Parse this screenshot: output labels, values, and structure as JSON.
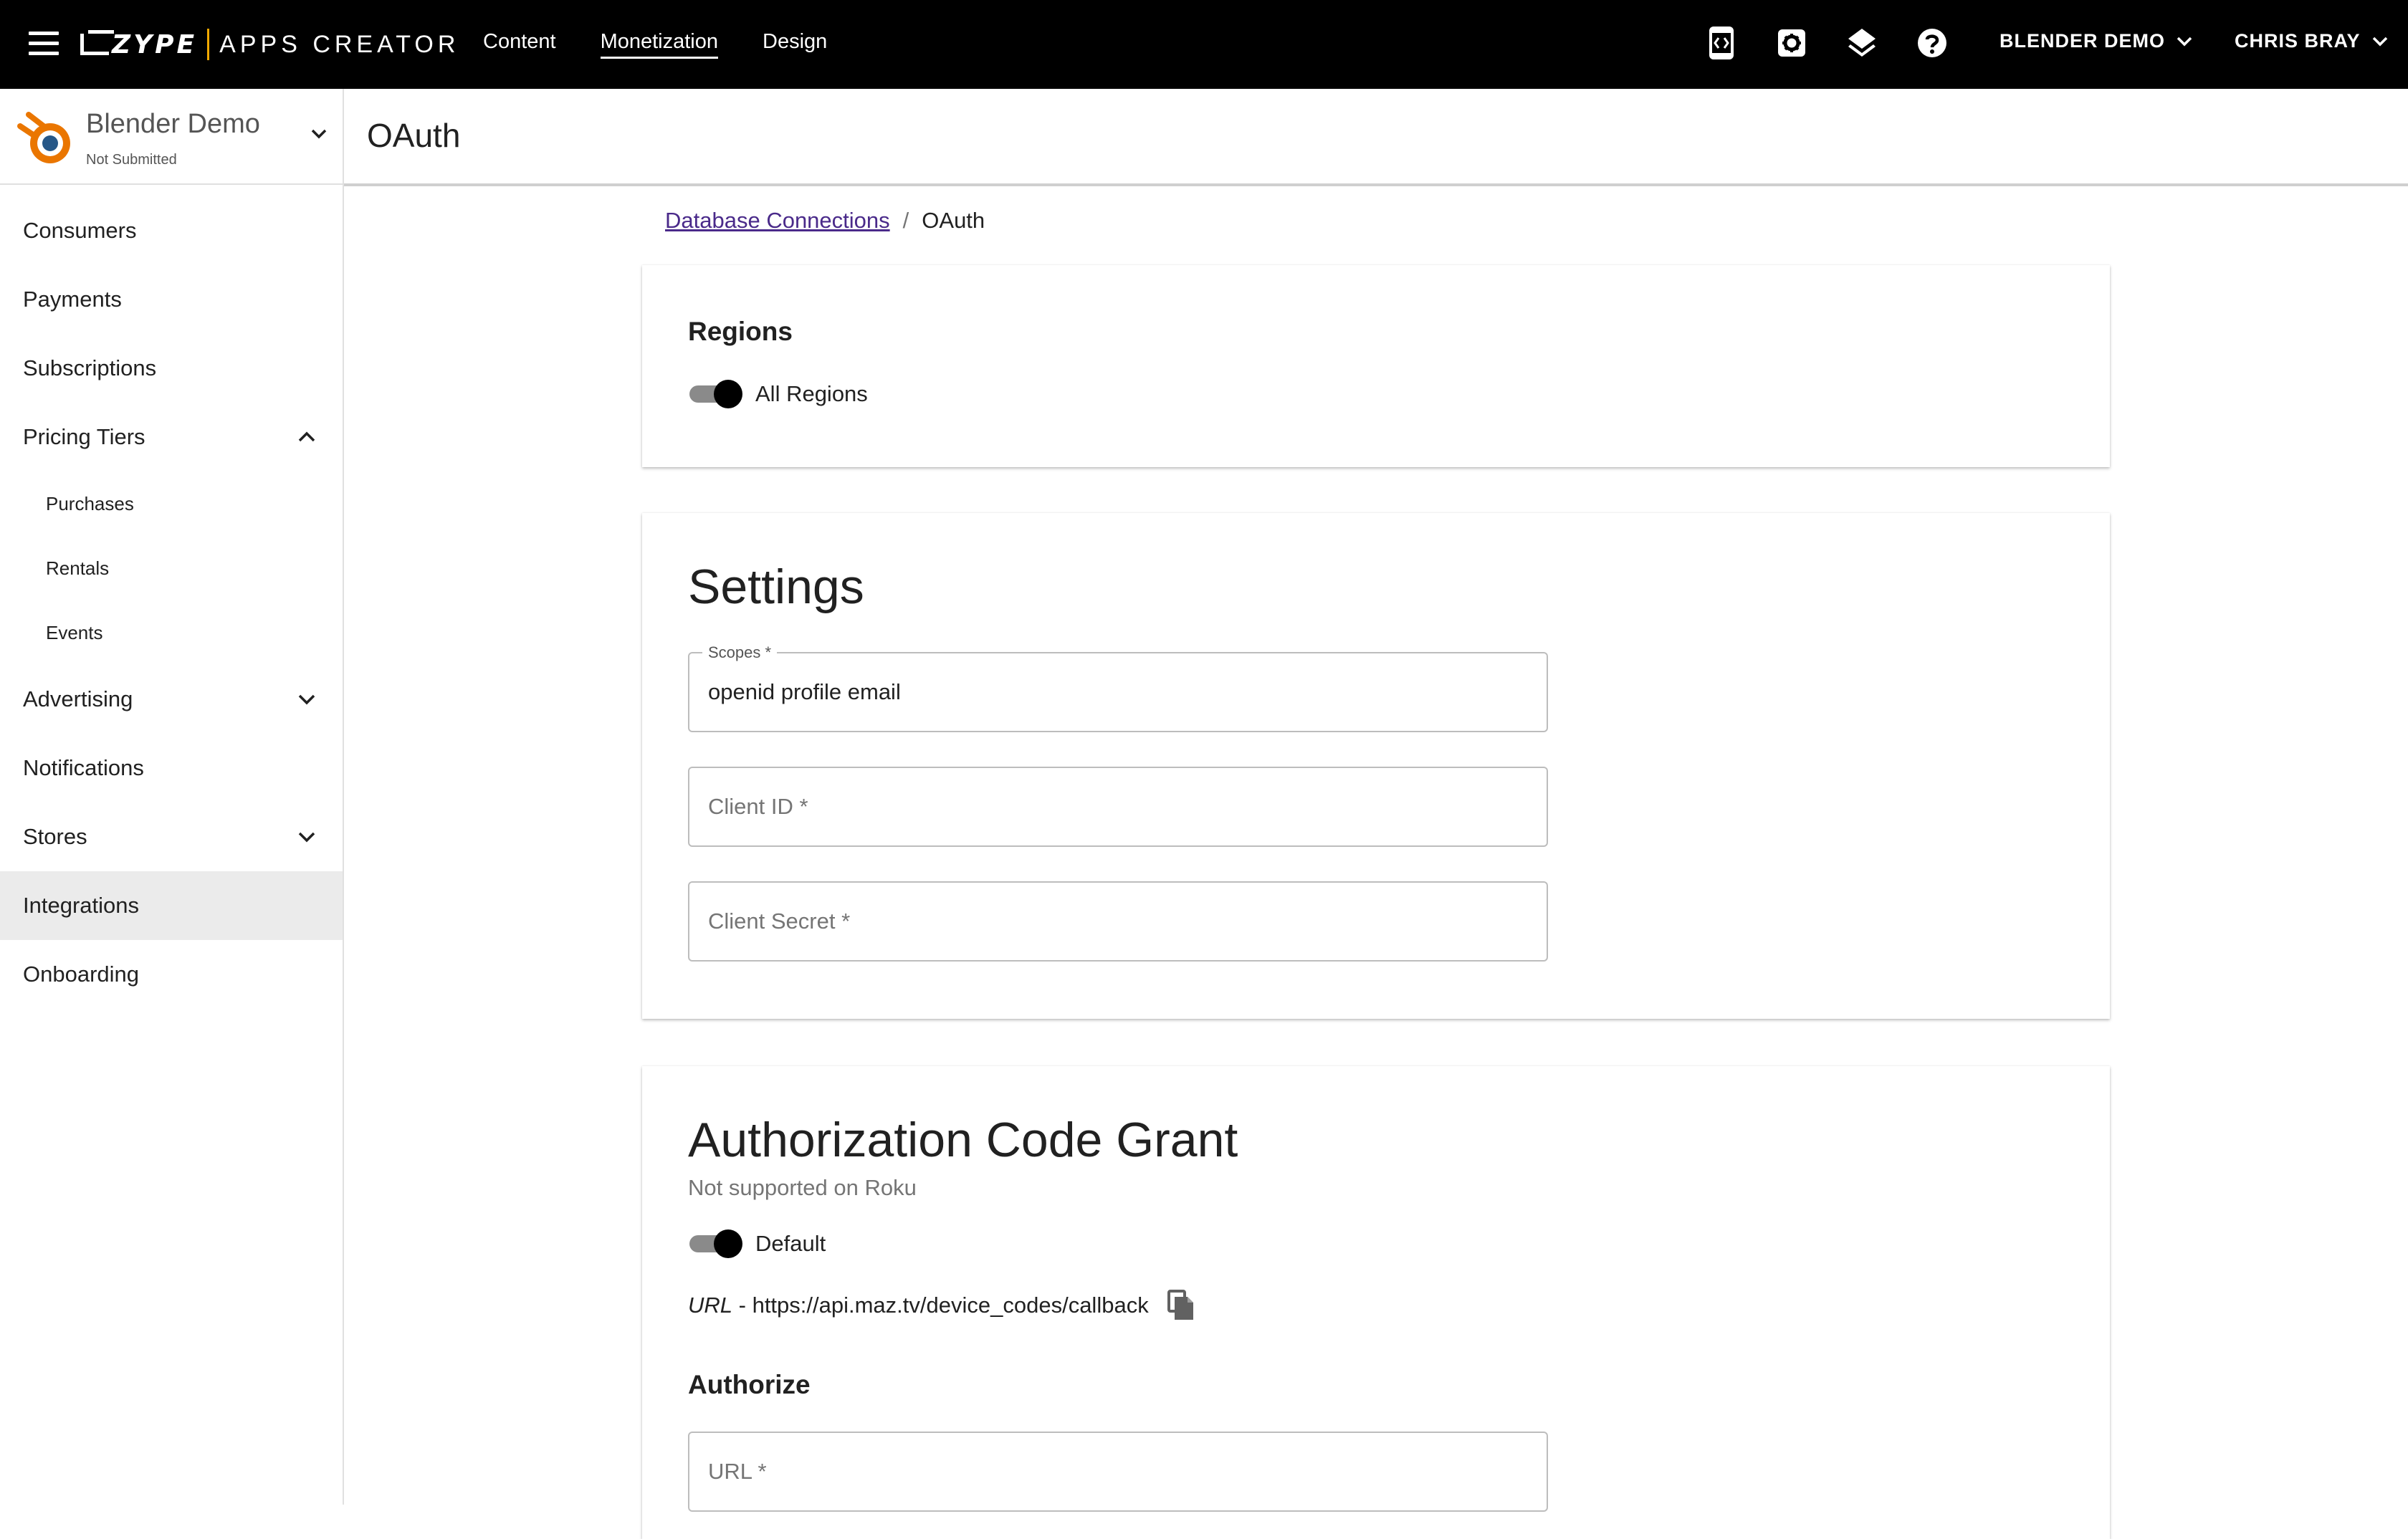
{
  "topbar": {
    "brand_zype": "ZYPE",
    "brand_apps": "APPS CREATOR",
    "nav": [
      "Content",
      "Monetization",
      "Design"
    ],
    "active_nav": "Monetization",
    "icons": [
      "code-preview-icon",
      "settings-icon",
      "layers-icon",
      "help-icon"
    ],
    "app_menu": "BLENDER DEMO",
    "user_menu": "CHRIS BRAY"
  },
  "app": {
    "name": "Blender Demo",
    "status": "Not Submitted"
  },
  "sidebar": {
    "items": [
      {
        "label": "Consumers"
      },
      {
        "label": "Payments"
      },
      {
        "label": "Subscriptions"
      },
      {
        "label": "Pricing Tiers",
        "expanded": true
      },
      {
        "label": "Purchases"
      },
      {
        "label": "Rentals"
      },
      {
        "label": "Events"
      },
      {
        "label": "Advertising",
        "expanded": false
      },
      {
        "label": "Notifications"
      },
      {
        "label": "Stores",
        "expanded": false
      },
      {
        "label": "Integrations",
        "selected": true
      },
      {
        "label": "Onboarding"
      }
    ]
  },
  "page": {
    "title": "OAuth",
    "breadcrumb": {
      "parent": "Database Connections",
      "separator": "/",
      "current": "OAuth"
    }
  },
  "regions": {
    "heading": "Regions",
    "toggle_label": "All Regions",
    "toggle_on": true
  },
  "settings": {
    "heading": "Settings",
    "scopes": {
      "label": "Scopes *",
      "value": "openid profile email"
    },
    "client_id": {
      "placeholder": "Client ID *"
    },
    "client_secret": {
      "placeholder": "Client Secret *"
    }
  },
  "auth_grant": {
    "heading": "Authorization Code Grant",
    "note": "Not supported on Roku",
    "toggle_label": "Default",
    "toggle_on": true,
    "url_label": "URL",
    "url_sep": " - ",
    "url_value": "https://api.maz.tv/device_codes/callback",
    "authorize_heading": "Authorize",
    "authorize_url": {
      "placeholder": "URL *"
    }
  }
}
